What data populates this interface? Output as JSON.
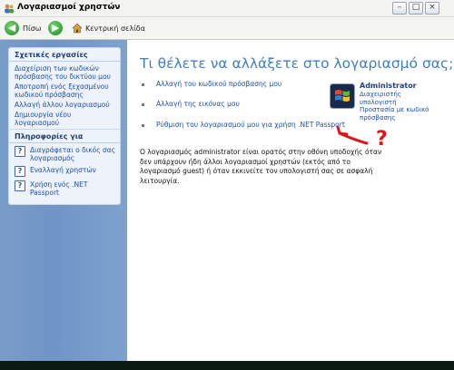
{
  "window": {
    "title": "Λογαριασμοί χρηστών"
  },
  "toolbar": {
    "back_label": "Πίσω",
    "home_label": "Κεντρική σελίδα"
  },
  "sidebar": {
    "tasks_title": "Σχετικές εργασίες",
    "tasks": [
      "Διαχείριση των κωδικών πρόσβασης του δικτύου μου",
      "Αποτροπή ενός ξεχασμένου κωδικού πρόσβασης",
      "Αλλαγή άλλου λογαριασμού",
      "Δημιουργία νέου λογαριασμού"
    ],
    "info_title": "Πληροφορίες για",
    "info": [
      "Διαγράφεται ο δικός σας λογαριασμός",
      "Εναλλαγή χρηστών",
      "Χρήση ενός .NET Passport"
    ]
  },
  "main": {
    "heading": "Τι θέλετε να αλλάξετε στο λογαριασμό σας;",
    "options": [
      "Αλλαγή του κωδικού πρόσβασης μου",
      "Αλλαγή της εικόνας μου",
      "Ρύθμιση του λογαριασμού μου για χρήση .NET Passport"
    ],
    "user": {
      "name": "Administrator",
      "role": "Διαχειριστής υπολογιστή",
      "protection": "Προστασία με κωδικό πρόσβασης"
    },
    "description": "Ο λογαριασμός administrator είναι ορατός στην οθόνη υποδοχής όταν δεν υπάρχουν ήδη άλλοι λογαριασμοί χρηστών (εκτός από το λογαριασμό guest) ή όταν εκκινείτε τον υπολογιστή σας σε ασφαλή λειτουργία."
  },
  "annotation": {
    "mark": "?",
    "color": "#e0141a"
  }
}
